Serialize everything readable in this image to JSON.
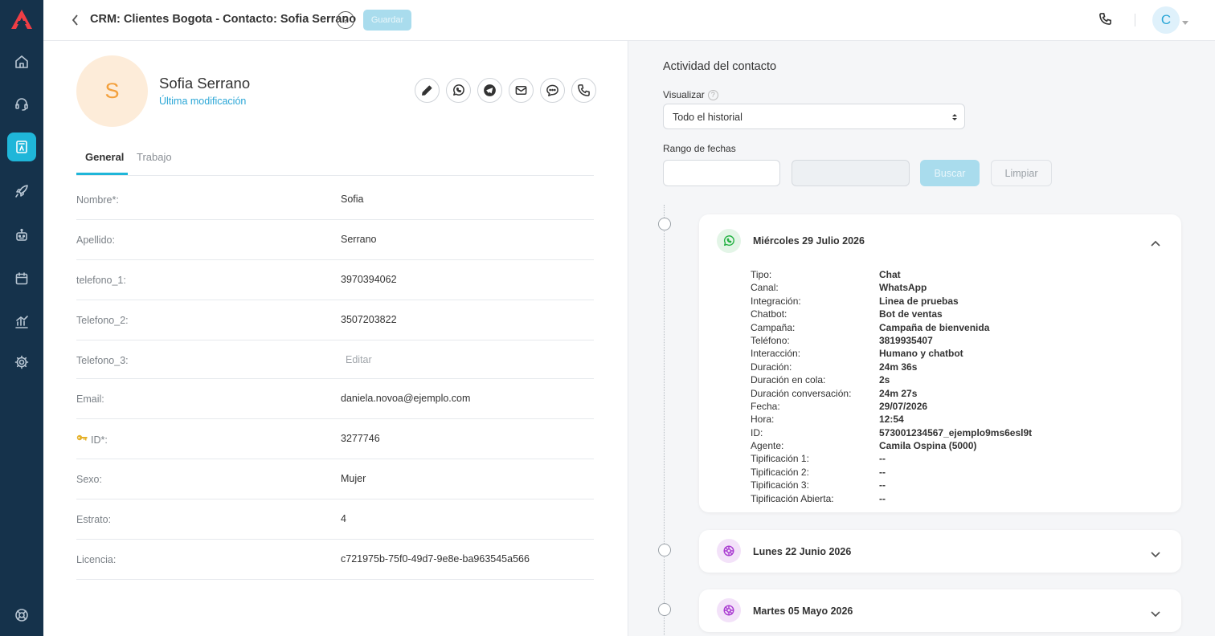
{
  "app": {
    "page_title": "CRM: Clientes Bogota - Contacto: Sofia Serrano",
    "help_label": "?",
    "save_label": "Guardar",
    "user_initial": "C"
  },
  "sidebar": {
    "items": [
      {
        "name": "home",
        "icon": "home-icon"
      },
      {
        "name": "support",
        "icon": "headset-icon"
      },
      {
        "name": "contacts",
        "icon": "contacts-book-icon",
        "active": true
      },
      {
        "name": "campaigns",
        "icon": "rocket-icon"
      },
      {
        "name": "bots",
        "icon": "robot-icon"
      },
      {
        "name": "calendar",
        "icon": "calendar-icon"
      },
      {
        "name": "reports",
        "icon": "bar-chart-icon"
      },
      {
        "name": "settings",
        "icon": "gear-icon"
      },
      {
        "name": "help-center",
        "icon": "lifebuoy-icon"
      }
    ]
  },
  "contact": {
    "initial": "S",
    "name": "Sofia Serrano",
    "last_modified_label": "Última modificación",
    "actions": [
      "edit-icon",
      "whatsapp-icon",
      "telegram-icon",
      "email-icon",
      "chat-bubble-icon",
      "phone-icon"
    ]
  },
  "tabs": [
    {
      "label": "General",
      "active": true
    },
    {
      "label": "Trabajo",
      "active": false
    }
  ],
  "fields": [
    {
      "label": "Nombre*:",
      "value": "Sofia"
    },
    {
      "label": "Apellido:",
      "value": "Serrano"
    },
    {
      "label": "telefono_1:",
      "value": "3970394062"
    },
    {
      "label": "Telefono_2:",
      "value": "3507203822"
    },
    {
      "label": "Telefono_3:",
      "value": "Editar",
      "placeholder": true
    },
    {
      "label": "Email:",
      "value": "daniela.novoa@ejemplo.com"
    },
    {
      "label": "ID*:",
      "value": "3277746",
      "key_icon": true
    },
    {
      "label": "Sexo:",
      "value": "Mujer"
    },
    {
      "label": "Estrato:",
      "value": "4"
    },
    {
      "label": "Licencia:",
      "value": "c721975b-75f0-49d7-9e8e-ba963545a566"
    }
  ],
  "activity": {
    "title": "Actividad del contacto",
    "view_label": "Visualizar",
    "view_help": "?",
    "view_selected": "Todo el historial",
    "date_range_label": "Rango de fechas",
    "search_label": "Buscar",
    "clear_label": "Limpiar",
    "entries": [
      {
        "date": "Miércoles 29 Julio 2026",
        "channel_icon": "whatsapp-icon",
        "expanded": true,
        "details": [
          {
            "label": "Tipo:",
            "value": "Chat"
          },
          {
            "label": "Canal:",
            "value": "WhatsApp"
          },
          {
            "label": "Integración:",
            "value": "Linea de pruebas"
          },
          {
            "label": "Chatbot:",
            "value": "Bot de ventas"
          },
          {
            "label": "Campaña:",
            "value": "Campaña de bienvenida"
          },
          {
            "label": "Teléfono:",
            "value": "3819935407"
          },
          {
            "label": "Interacción:",
            "value": "Humano y chatbot"
          },
          {
            "label": "Duración:",
            "value": "24m 36s"
          },
          {
            "label": "Duración en cola:",
            "value": "2s"
          },
          {
            "label": "Duración conversación:",
            "value": "24m 27s"
          },
          {
            "label": "Fecha:",
            "value": "29/07/2026"
          },
          {
            "label": "Hora:",
            "value": "12:54"
          },
          {
            "label": "ID:",
            "value": "573001234567_ejemplo9ms6esl9t"
          },
          {
            "label": "Agente:",
            "value": "Camila Ospina (5000)"
          },
          {
            "label": "Tipificación 1:",
            "value": "--"
          },
          {
            "label": "Tipificación 2:",
            "value": "--"
          },
          {
            "label": "Tipificación 3:",
            "value": "--"
          },
          {
            "label": "Tipificación Abierta:",
            "value": "--"
          }
        ]
      },
      {
        "date": "Lunes 22 Junio 2026",
        "channel_icon": "web-chat-icon",
        "expanded": false
      },
      {
        "date": "Martes 05 Mayo 2026",
        "channel_icon": "web-chat-icon",
        "expanded": false
      }
    ]
  },
  "colors": {
    "rail_bg": "#15324b",
    "accent": "#1fb6d9",
    "whatsapp": "#25b244",
    "webchat": "#a93bd1",
    "avatar_bg": "#fdecd9",
    "avatar_fg": "#f3a03c"
  }
}
